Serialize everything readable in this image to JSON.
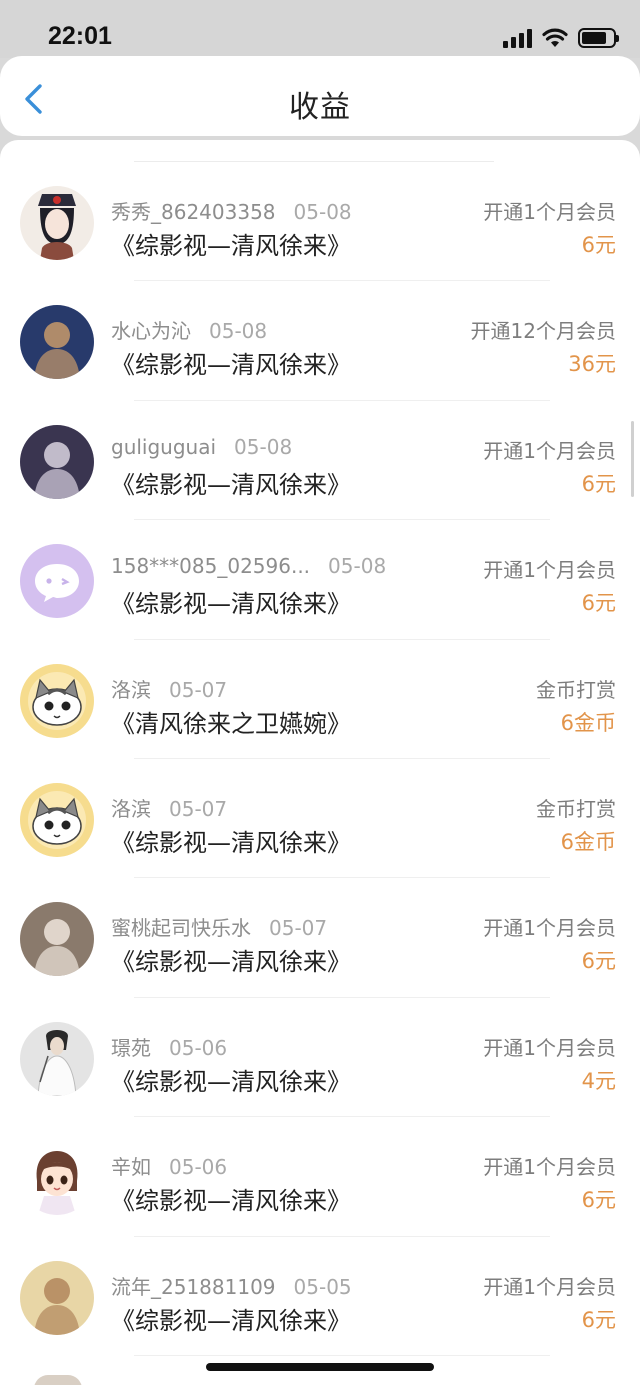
{
  "status_bar": {
    "time": "22:01"
  },
  "nav": {
    "title": "收益"
  },
  "rows": [
    {
      "avatar_icon": "avatar-ancient-lady",
      "avatar_colors": [
        "#d9c3b6",
        "#8a4b3d"
      ],
      "name": "秀秀_862403358",
      "date": "05-08",
      "book": "《综影视—清风徐来》",
      "type": "开通1个月会员",
      "amount": "6元"
    },
    {
      "avatar_icon": "avatar-anime-boy",
      "avatar_colors": [
        "#283a6b",
        "#c79a6a"
      ],
      "name": "水心为沁",
      "date": "05-08",
      "book": "《综影视—清风徐来》",
      "type": "开通12个月会员",
      "amount": "36元"
    },
    {
      "avatar_icon": "avatar-girl-photo",
      "avatar_colors": [
        "#3a3550",
        "#d9d2df"
      ],
      "name": "guliguguai",
      "date": "05-08",
      "book": "《综影视—清风徐来》",
      "type": "开通1个月会员",
      "amount": "6元"
    },
    {
      "avatar_icon": "avatar-default-chat",
      "avatar_colors": [
        "#d4c0ef",
        "#ffffff"
      ],
      "name": "158***085_02596...",
      "date": "05-08",
      "book": "《综影视—清风徐来》",
      "type": "开通1个月会员",
      "amount": "6元"
    },
    {
      "avatar_icon": "avatar-cartoon-cat",
      "avatar_colors": [
        "#f6dc8e",
        "#ffffff"
      ],
      "name": "洛滨",
      "date": "05-07",
      "book": "《清风徐来之卫嬿婉》",
      "type": "金币打赏",
      "amount": "6金币"
    },
    {
      "avatar_icon": "avatar-cartoon-cat",
      "avatar_colors": [
        "#f6dc8e",
        "#ffffff"
      ],
      "name": "洛滨",
      "date": "05-07",
      "book": "《综影视—清风徐来》",
      "type": "金币打赏",
      "amount": "6金币"
    },
    {
      "avatar_icon": "avatar-kitten-photo",
      "avatar_colors": [
        "#8a7a6c",
        "#eee5dc"
      ],
      "name": "蜜桃起司快乐水",
      "date": "05-07",
      "book": "《综影视—清风徐来》",
      "type": "开通1个月会员",
      "amount": "6元"
    },
    {
      "avatar_icon": "avatar-white-robe",
      "avatar_colors": [
        "#e4e4e4",
        "#555555"
      ],
      "name": "璟苑",
      "date": "05-06",
      "book": "《综影视—清风徐来》",
      "type": "开通1个月会员",
      "amount": "4元"
    },
    {
      "avatar_icon": "avatar-chibi-girl",
      "avatar_colors": [
        "#ffffff",
        "#6b4031"
      ],
      "name": "辛如",
      "date": "05-06",
      "book": "《综影视—清风徐来》",
      "type": "开通1个月会员",
      "amount": "6元"
    },
    {
      "avatar_icon": "avatar-golden-robe",
      "avatar_colors": [
        "#e8d6a6",
        "#b1865c"
      ],
      "name": "流年_251881109",
      "date": "05-05",
      "book": "《综影视—清风徐来》",
      "type": "开通1个月会员",
      "amount": "6元"
    }
  ]
}
